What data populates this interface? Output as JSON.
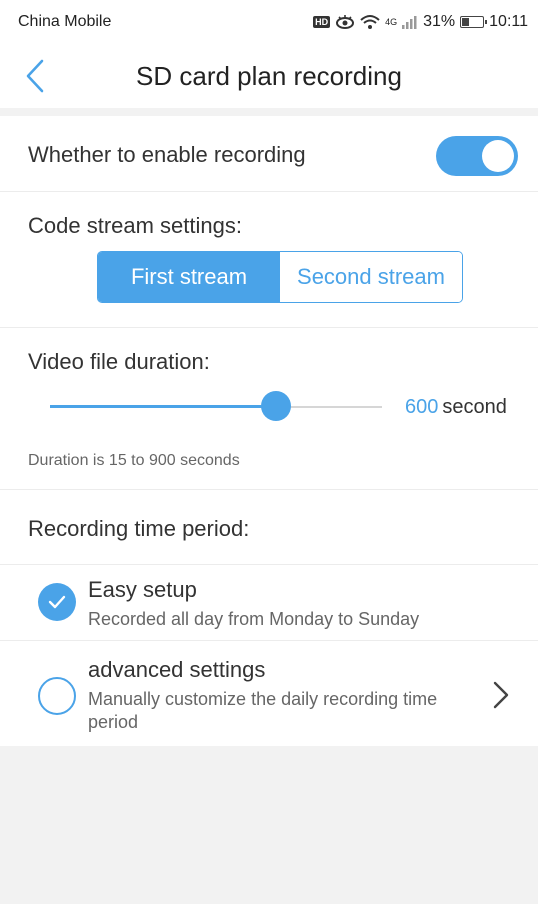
{
  "status_bar": {
    "carrier": "China Mobile",
    "hd_label": "HD",
    "network": "4G",
    "battery": "31%",
    "time": "10:11"
  },
  "header": {
    "title": "SD card plan recording"
  },
  "recording": {
    "enable_label": "Whether to enable recording",
    "enabled": true
  },
  "code_stream": {
    "label": "Code stream settings:",
    "options": [
      "First stream",
      "Second stream"
    ],
    "selected_index": 0
  },
  "duration": {
    "label": "Video file duration:",
    "value": "600",
    "unit": "second",
    "min": 15,
    "max": 900,
    "slider_fraction": 0.68,
    "hint": "Duration is 15 to 900 seconds"
  },
  "period": {
    "label": "Recording time period:",
    "options": [
      {
        "title": "Easy setup",
        "desc": "Recorded all day from Monday to Sunday",
        "selected": true
      },
      {
        "title": "advanced settings",
        "desc": "Manually customize the daily recording time period",
        "selected": false
      }
    ]
  },
  "colors": {
    "accent": "#4aa3e8",
    "background": "#f2f2f2",
    "card": "#ffffff"
  }
}
